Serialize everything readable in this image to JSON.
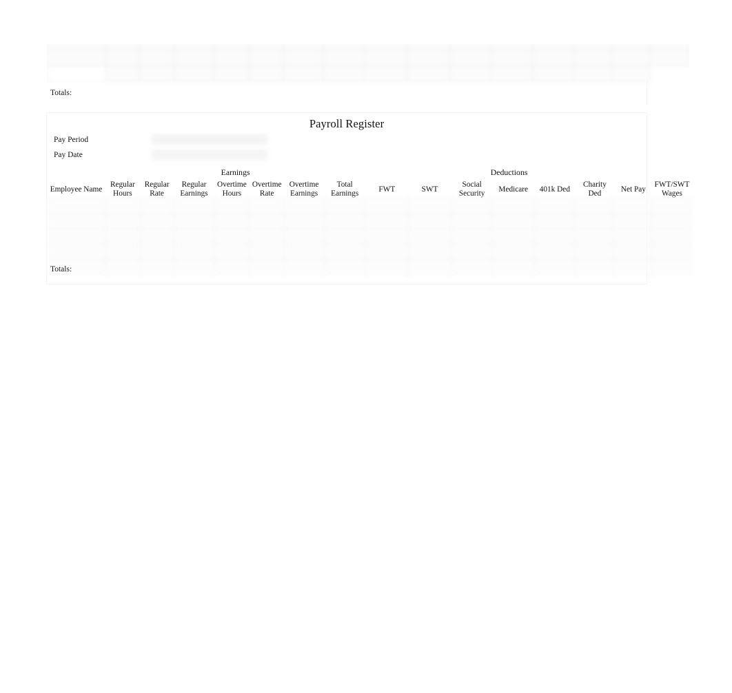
{
  "document": {
    "title": "Payroll Register",
    "background_color": "#ffffff",
    "text_color": "#141414",
    "grid_line_color": "#e8e8e8"
  },
  "upper_register": {
    "totals_label": "Totals:",
    "blank_data_rows": 3,
    "column_count": 15,
    "state": "blurred-clipped"
  },
  "lower_register": {
    "title": "Payroll Register",
    "fields": [
      {
        "label": "Pay Period",
        "value": ""
      },
      {
        "label": "Pay Date",
        "value": ""
      }
    ],
    "group_headers": [
      {
        "label": "Earnings",
        "span_start": "Regular Hours",
        "span_end": "Total Earnings"
      },
      {
        "label": "Deductions",
        "span_start": "FWT",
        "span_end": "Net Pay"
      }
    ],
    "columns": [
      {
        "label": "Employee Name",
        "line1": "Employee Name",
        "line2": ""
      },
      {
        "label": "Regular Hours",
        "line1": "Regular",
        "line2": "Hours"
      },
      {
        "label": "Regular Rate",
        "line1": "Regular",
        "line2": "Rate"
      },
      {
        "label": "Regular Earnings",
        "line1": "Regular",
        "line2": "Earnings"
      },
      {
        "label": "Overtime Hours",
        "line1": "Overtime",
        "line2": "Hours"
      },
      {
        "label": "Overtime Rate",
        "line1": "Overtime",
        "line2": "Rate"
      },
      {
        "label": "Overtime Earnings",
        "line1": "Overtime",
        "line2": "Earnings"
      },
      {
        "label": "Total Earnings",
        "line1": "Total",
        "line2": "Earnings"
      },
      {
        "label": "FWT",
        "line1": "FWT",
        "line2": ""
      },
      {
        "label": "SWT",
        "line1": "SWT",
        "line2": ""
      },
      {
        "label": "Social Security",
        "line1": "Social",
        "line2": "Security"
      },
      {
        "label": "Medicare",
        "line1": "Medicare",
        "line2": ""
      },
      {
        "label": "401k Ded",
        "line1": "401k Ded",
        "line2": ""
      },
      {
        "label": "Charity Ded",
        "line1": "Charity",
        "line2": "Ded"
      },
      {
        "label": "Net Pay",
        "line1": "Net Pay",
        "line2": ""
      },
      {
        "label": "FWT/SWT Wages",
        "line1": "FWT/SWT",
        "line2": "Wages"
      }
    ],
    "rows": [
      {
        "employee_name": "",
        "regular_hours": "",
        "regular_rate": "",
        "regular_earnings": "",
        "overtime_hours": "",
        "overtime_rate": "",
        "overtime_earnings": "",
        "total_earnings": "",
        "fwt": "",
        "swt": "",
        "social_security": "",
        "medicare": "",
        "k401_ded": "",
        "charity_ded": "",
        "net_pay": "",
        "fwt_swt_wages": ""
      },
      {
        "employee_name": "",
        "regular_hours": "",
        "regular_rate": "",
        "regular_earnings": "",
        "overtime_hours": "",
        "overtime_rate": "",
        "overtime_earnings": "",
        "total_earnings": "",
        "fwt": "",
        "swt": "",
        "social_security": "",
        "medicare": "",
        "k401_ded": "",
        "charity_ded": "",
        "net_pay": "",
        "fwt_swt_wages": ""
      },
      {
        "employee_name": "",
        "regular_hours": "",
        "regular_rate": "",
        "regular_earnings": "",
        "overtime_hours": "",
        "overtime_rate": "",
        "overtime_earnings": "",
        "total_earnings": "",
        "fwt": "",
        "swt": "",
        "social_security": "",
        "medicare": "",
        "k401_ded": "",
        "charity_ded": "",
        "net_pay": "",
        "fwt_swt_wages": ""
      },
      {
        "employee_name": "",
        "regular_hours": "",
        "regular_rate": "",
        "regular_earnings": "",
        "overtime_hours": "",
        "overtime_rate": "",
        "overtime_earnings": "",
        "total_earnings": "",
        "fwt": "",
        "swt": "",
        "social_security": "",
        "medicare": "",
        "k401_ded": "",
        "charity_ded": "",
        "net_pay": "",
        "fwt_swt_wages": ""
      }
    ],
    "totals_label": "Totals:"
  }
}
